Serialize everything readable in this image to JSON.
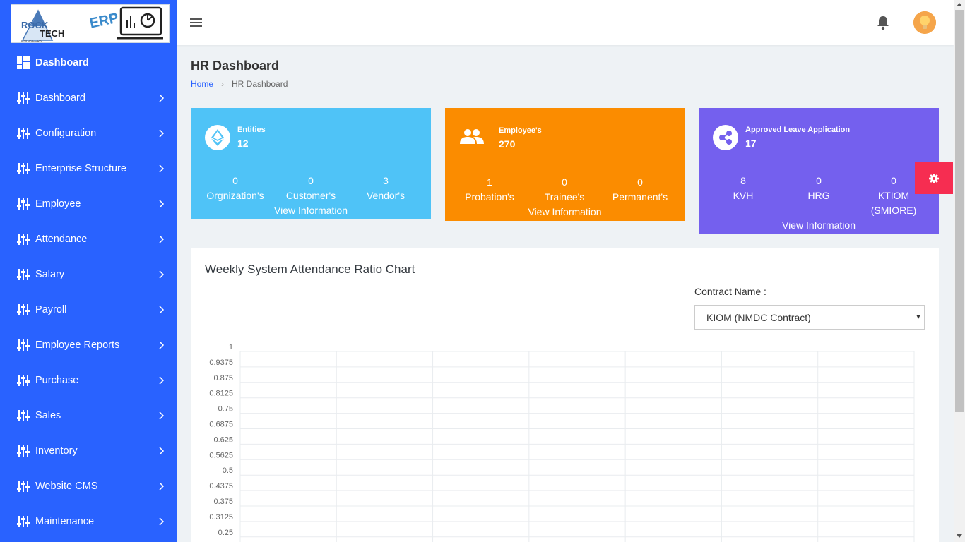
{
  "brand": {
    "logo_text_1": "ROCK",
    "logo_text_2": "TECH",
    "logo_text_3": "ENGINEERS",
    "logo_text_4": "ERP"
  },
  "sidebar": {
    "items": [
      {
        "label": "Dashboard",
        "icon": "dashboard-grid-icon"
      },
      {
        "label": "Dashboard",
        "icon": "sliders-icon"
      },
      {
        "label": "Configuration",
        "icon": "sliders-icon"
      },
      {
        "label": "Enterprise Structure",
        "icon": "sliders-icon"
      },
      {
        "label": "Employee",
        "icon": "sliders-icon"
      },
      {
        "label": "Attendance",
        "icon": "sliders-icon"
      },
      {
        "label": "Salary",
        "icon": "sliders-icon"
      },
      {
        "label": "Payroll",
        "icon": "sliders-icon"
      },
      {
        "label": "Employee Reports",
        "icon": "sliders-icon"
      },
      {
        "label": "Purchase",
        "icon": "sliders-icon"
      },
      {
        "label": "Sales",
        "icon": "sliders-icon"
      },
      {
        "label": "Inventory",
        "icon": "sliders-icon"
      },
      {
        "label": "Website CMS",
        "icon": "sliders-icon"
      },
      {
        "label": "Maintenance",
        "icon": "sliders-icon"
      }
    ]
  },
  "page": {
    "title": "HR Dashboard",
    "breadcrumb_home": "Home",
    "breadcrumb_current": "HR Dashboard"
  },
  "cards": {
    "entities": {
      "title": "Entities",
      "value": "12",
      "color": "#4fc3f7",
      "stats": [
        {
          "n": "0",
          "t": "Orgnization's"
        },
        {
          "n": "0",
          "t": "Customer's"
        },
        {
          "n": "3",
          "t": "Vendor's"
        }
      ],
      "link": "View Information"
    },
    "employees": {
      "title": "Employee's",
      "value": "270",
      "color": "#fb8c00",
      "stats": [
        {
          "n": "1",
          "t": "Probation's"
        },
        {
          "n": "0",
          "t": "Trainee's"
        },
        {
          "n": "0",
          "t": "Permanent's"
        }
      ],
      "link": "View Information"
    },
    "leave": {
      "title": "Approved Leave Application",
      "value": "17",
      "color": "#7460ee",
      "stats": [
        {
          "n": "8",
          "t": "KVH"
        },
        {
          "n": "0",
          "t": "HRG"
        },
        {
          "n": "0",
          "t": "KTIOM (SMIORE)"
        }
      ],
      "link": "View Information"
    }
  },
  "chart_panel": {
    "title": "Weekly System Attendance Ratio Chart",
    "contract_label": "Contract Name :",
    "contract_value": "KIOM (NMDC Contract)"
  },
  "chart_data": {
    "type": "line",
    "title": "Weekly System Attendance Ratio Chart",
    "y_ticks": [
      "1",
      "0.9375",
      "0.875",
      "0.8125",
      "0.75",
      "0.6875",
      "0.625",
      "0.5625",
      "0.5",
      "0.4375",
      "0.375",
      "0.3125",
      "0.25"
    ],
    "ylim": [
      0.25,
      1
    ],
    "series": [],
    "grid": true,
    "vertical_gridlines": 8
  }
}
